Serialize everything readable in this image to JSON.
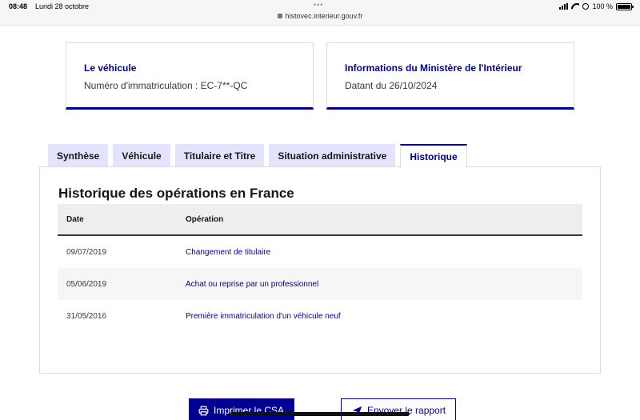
{
  "status_bar": {
    "time": "08:48",
    "date": "Lundi 28 octobre",
    "url": "histovec.interieur.gouv.fr",
    "battery": "100 %"
  },
  "tiles": {
    "vehicle": {
      "title": "Le véhicule",
      "text": "Numéro d'immatriculation : EC-7**-QC"
    },
    "ministry": {
      "title": "Informations du Ministère de l'Intérieur",
      "text": "Datant du 26/10/2024"
    }
  },
  "tabs": [
    {
      "label": "Synthèse"
    },
    {
      "label": "Véhicule"
    },
    {
      "label": "Titulaire et Titre"
    },
    {
      "label": "Situation administrative"
    },
    {
      "label": "Historique",
      "active": true
    }
  ],
  "history": {
    "title": "Historique des opérations en France",
    "columns": {
      "date": "Date",
      "operation": "Opération"
    },
    "rows": [
      {
        "date": "09/07/2019",
        "operation": "Changement de titulaire"
      },
      {
        "date": "05/06/2019",
        "operation": "Achat ou reprise par un professionnel"
      },
      {
        "date": "31/05/2016",
        "operation": "Première immatriculation d'un véhicule neuf"
      }
    ]
  },
  "actions": {
    "print": "Imprimer le CSA",
    "send": "Envoyer le rapport"
  },
  "colors": {
    "primary": "#000091",
    "tab_bg": "#e3e3fd"
  }
}
